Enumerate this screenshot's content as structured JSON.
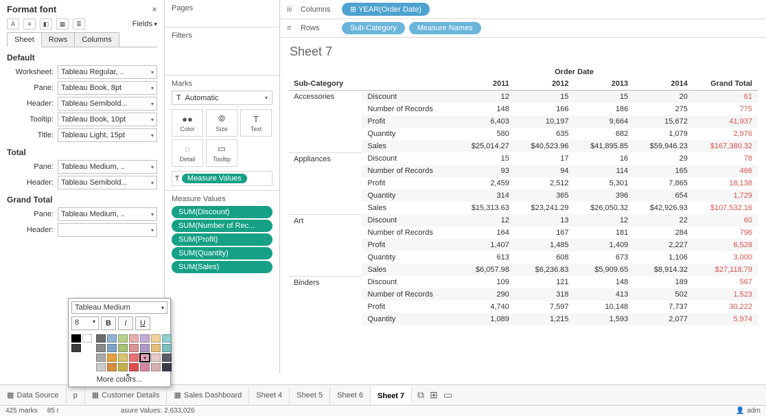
{
  "format": {
    "title": "Format font",
    "fields_label": "Fields",
    "tabs": [
      "Sheet",
      "Rows",
      "Columns"
    ],
    "active_tab": 0,
    "sections": {
      "default": {
        "title": "Default",
        "rows": [
          {
            "label": "Worksheet:",
            "value": "Tableau Regular, .."
          },
          {
            "label": "Pane:",
            "value": "Tableau Book, 8pt"
          },
          {
            "label": "Header:",
            "value": "Tableau Semibold..."
          },
          {
            "label": "Tooltip:",
            "value": "Tableau Book, 10pt"
          },
          {
            "label": "Title:",
            "value": "Tableau Light, 15pt"
          }
        ]
      },
      "total": {
        "title": "Total",
        "rows": [
          {
            "label": "Pane:",
            "value": "Tableau Medium, .."
          },
          {
            "label": "Header:",
            "value": "Tableau Semibold..."
          }
        ]
      },
      "grand_total": {
        "title": "Grand Total",
        "rows": [
          {
            "label": "Pane:",
            "value": "Tableau Medium, .."
          },
          {
            "label": "Header:",
            "value": ""
          }
        ]
      }
    },
    "toolbar_icons": [
      "A",
      "align",
      "shade",
      "border",
      "stack"
    ]
  },
  "font_popup": {
    "font": "Tableau Medium",
    "size": "8",
    "more": "More colors...",
    "palette": [
      [
        "#000000",
        "#ffffff",
        "",
        "#6b6b6b",
        "#8fb4d6",
        "#b7d28f",
        "#e8b0b0",
        "#c3add6",
        "#f1d29b",
        "#8fcfd0"
      ],
      [
        "#3c3c3c",
        "",
        "",
        "#8a8a8a",
        "#7da4c8",
        "#a7c378",
        "#d99595",
        "#b09ac8",
        "#e6c07a",
        "#7bbebe"
      ],
      [
        "",
        "",
        "",
        "#aaaaaa",
        "#e6a23c",
        "#d6c46e",
        "#e67373",
        "#e6a3b8",
        "#e6c9c9",
        "#5a5a6a"
      ],
      [
        "",
        "",
        "",
        "#cccccc",
        "#d98c3c",
        "#c2b24e",
        "#e05050",
        "#d687a0",
        "#d6b0b0",
        "#3a3a4a"
      ]
    ],
    "selected_index": [
      2,
      7
    ]
  },
  "middle": {
    "pages": "Pages",
    "filters": "Filters",
    "marks": "Marks",
    "marks_type": "Automatic",
    "mark_cells": [
      {
        "ic": "●●",
        "label": "Color"
      },
      {
        "ic": "⦾",
        "label": "Size"
      },
      {
        "ic": "T",
        "label": "Text"
      },
      {
        "ic": "◌",
        "label": "Detail"
      },
      {
        "ic": "▭",
        "label": "Tooltip"
      }
    ],
    "mv_box_label": "Measure Values",
    "mv_title": "Measure Values",
    "mv_items": [
      "SUM(Discount)",
      "SUM(Number of Rec...",
      "SUM(Profit)",
      "SUM(Quantity)",
      "SUM(Sales)"
    ]
  },
  "viz": {
    "columns_label": "Columns",
    "rows_label": "Rows",
    "col_pill": "YEAR(Order Date)",
    "row_pills": [
      "Sub-Category",
      "Measure Names"
    ],
    "sheet_title": "Sheet 7",
    "top_header": "Order Date",
    "headers": [
      "Sub-Category",
      "",
      "2011",
      "2012",
      "2013",
      "2014",
      "Grand Total"
    ],
    "rows": [
      {
        "cat": "Accessories",
        "items": [
          {
            "m": "Discount",
            "v": [
              "12",
              "15",
              "15",
              "20"
            ],
            "gt": "61"
          },
          {
            "m": "Number of Records",
            "v": [
              "148",
              "166",
              "186",
              "275"
            ],
            "gt": "775"
          },
          {
            "m": "Profit",
            "v": [
              "6,403",
              "10,197",
              "9,664",
              "15,672"
            ],
            "gt": "41,937"
          },
          {
            "m": "Quantity",
            "v": [
              "580",
              "635",
              "682",
              "1,079"
            ],
            "gt": "2,976"
          },
          {
            "m": "Sales",
            "v": [
              "$25,014.27",
              "$40,523.96",
              "$41,895.85",
              "$59,946.23"
            ],
            "gt": "$167,380.32"
          }
        ]
      },
      {
        "cat": "Appliances",
        "items": [
          {
            "m": "Discount",
            "v": [
              "15",
              "17",
              "16",
              "29"
            ],
            "gt": "78"
          },
          {
            "m": "Number of Records",
            "v": [
              "93",
              "94",
              "114",
              "165"
            ],
            "gt": "466"
          },
          {
            "m": "Profit",
            "v": [
              "2,459",
              "2,512",
              "5,301",
              "7,865"
            ],
            "gt": "18,138"
          },
          {
            "m": "Quantity",
            "v": [
              "314",
              "365",
              "396",
              "654"
            ],
            "gt": "1,729"
          },
          {
            "m": "Sales",
            "v": [
              "$15,313.63",
              "$23,241.29",
              "$26,050.32",
              "$42,926.93"
            ],
            "gt": "$107,532.16"
          }
        ]
      },
      {
        "cat": "Art",
        "items": [
          {
            "m": "Discount",
            "v": [
              "12",
              "13",
              "12",
              "22"
            ],
            "gt": "60"
          },
          {
            "m": "Number of Records",
            "v": [
              "164",
              "167",
              "181",
              "284"
            ],
            "gt": "796"
          },
          {
            "m": "Profit",
            "v": [
              "1,407",
              "1,485",
              "1,409",
              "2,227"
            ],
            "gt": "6,528"
          },
          {
            "m": "Quantity",
            "v": [
              "613",
              "608",
              "673",
              "1,106"
            ],
            "gt": "3,000"
          },
          {
            "m": "Sales",
            "v": [
              "$6,057.98",
              "$6,236.83",
              "$5,909.65",
              "$8,914.32"
            ],
            "gt": "$27,118.79"
          }
        ]
      },
      {
        "cat": "Binders",
        "items": [
          {
            "m": "Discount",
            "v": [
              "109",
              "121",
              "148",
              "189"
            ],
            "gt": "567"
          },
          {
            "m": "Number of Records",
            "v": [
              "290",
              "318",
              "413",
              "502"
            ],
            "gt": "1,523"
          },
          {
            "m": "Profit",
            "v": [
              "4,740",
              "7,597",
              "10,148",
              "7,737"
            ],
            "gt": "30,222"
          },
          {
            "m": "Quantity",
            "v": [
              "1,089",
              "1,215",
              "1,593",
              "2,077"
            ],
            "gt": "5,974"
          }
        ]
      }
    ]
  },
  "tabs": {
    "data_source": "Data Source",
    "items": [
      "p",
      "Customer Details",
      "Sales Dashboard",
      "Sheet 4",
      "Sheet 5",
      "Sheet 6",
      "Sheet 7"
    ],
    "active": 6
  },
  "status": {
    "marks": "425 marks",
    "re": "85 r",
    "mv": "asure Values: 2.633,026",
    "user": "adm"
  }
}
